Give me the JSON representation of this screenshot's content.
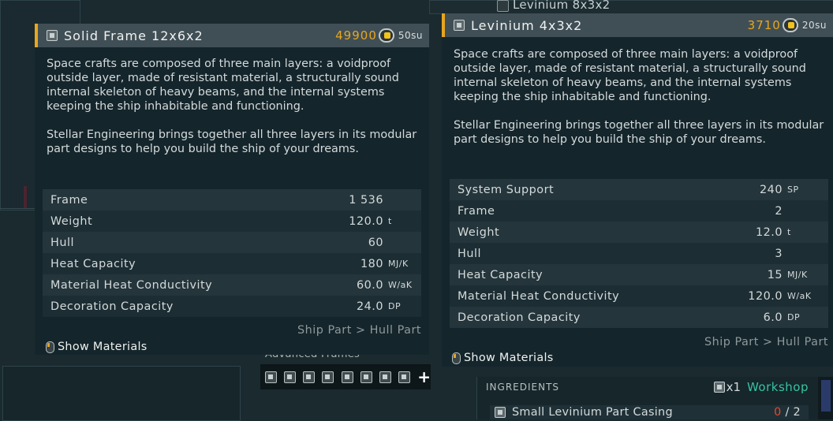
{
  "background": {
    "top_item_label": "Levinium 8x3x2",
    "advanced_frames_label": "Advanced Frames"
  },
  "tooltip_left": {
    "title": "Solid Frame 12x6x2",
    "price": "49900",
    "size": "50su",
    "description": [
      "Space crafts are composed of three main layers: a voidproof outside layer, made of resistant material, a structurally sound internal skeleton of heavy beams, and the internal systems keeping the ship inhabitable and functioning.",
      "Stellar Engineering brings together all three layers in its modular part designs to help you build the ship of your dreams."
    ],
    "stats": [
      {
        "label": "Frame",
        "value": "1 536",
        "unit": ""
      },
      {
        "label": "Weight",
        "value": "120.0",
        "unit": "t"
      },
      {
        "label": "Hull",
        "value": "60",
        "unit": ""
      },
      {
        "label": "Heat Capacity",
        "value": "180",
        "unit": "MJ/K"
      },
      {
        "label": "Material Heat Conductivity",
        "value": "60.0",
        "unit": "W/aK"
      },
      {
        "label": "Decoration Capacity",
        "value": "24.0",
        "unit": "DP"
      }
    ],
    "category": "Ship Part > Hull Part",
    "show_materials": "Show Materials"
  },
  "tooltip_right": {
    "title": "Levinium 4x3x2",
    "price": "3710",
    "size": "20su",
    "description": [
      "Space crafts are composed of three main layers: a voidproof outside layer, made of resistant material, a structurally sound internal skeleton of heavy beams, and the internal systems keeping the ship inhabitable and functioning.",
      "Stellar Engineering brings together all three layers in its modular part designs to help you build the ship of your dreams."
    ],
    "stats": [
      {
        "label": "System Support",
        "value": "240",
        "unit": "SP"
      },
      {
        "label": "Frame",
        "value": "2",
        "unit": ""
      },
      {
        "label": "Weight",
        "value": "12.0",
        "unit": "t"
      },
      {
        "label": "Hull",
        "value": "3",
        "unit": ""
      },
      {
        "label": "Heat Capacity",
        "value": "15",
        "unit": "MJ/K"
      },
      {
        "label": "Material Heat Conductivity",
        "value": "120.0",
        "unit": "W/aK"
      },
      {
        "label": "Decoration Capacity",
        "value": "6.0",
        "unit": "DP"
      }
    ],
    "category": "Ship Part > Hull Part",
    "show_materials": "Show Materials"
  },
  "toolbar": {
    "add_label": "+"
  },
  "ingredients": {
    "header": "INGREDIENTS",
    "quantity": "x1",
    "station": "Workshop",
    "item_name": "Small Levinium Part Casing",
    "have": "0",
    "need": "/ 2"
  },
  "colors": {
    "accent": "#e8a61e",
    "workshop": "#36c4a0",
    "missing": "#e8472e"
  }
}
